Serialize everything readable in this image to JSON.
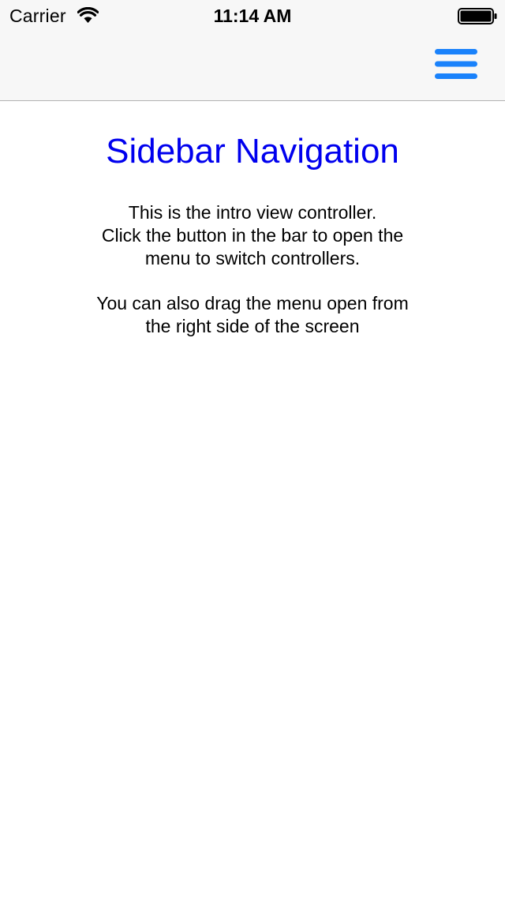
{
  "status_bar": {
    "carrier": "Carrier",
    "time": "11:14 AM",
    "wifi_icon": "wifi-icon",
    "battery_icon": "battery-icon"
  },
  "nav_bar": {
    "menu_icon": "hamburger-menu-icon",
    "accent_color": "#1a82fb"
  },
  "main": {
    "title": "Sidebar Navigation",
    "title_color": "#0000ee",
    "intro_text": "This is the intro view controller.\nClick the button in the bar to open the\nmenu to switch controllers.",
    "drag_text": "You can also drag the menu open from\nthe right side of the screen"
  }
}
